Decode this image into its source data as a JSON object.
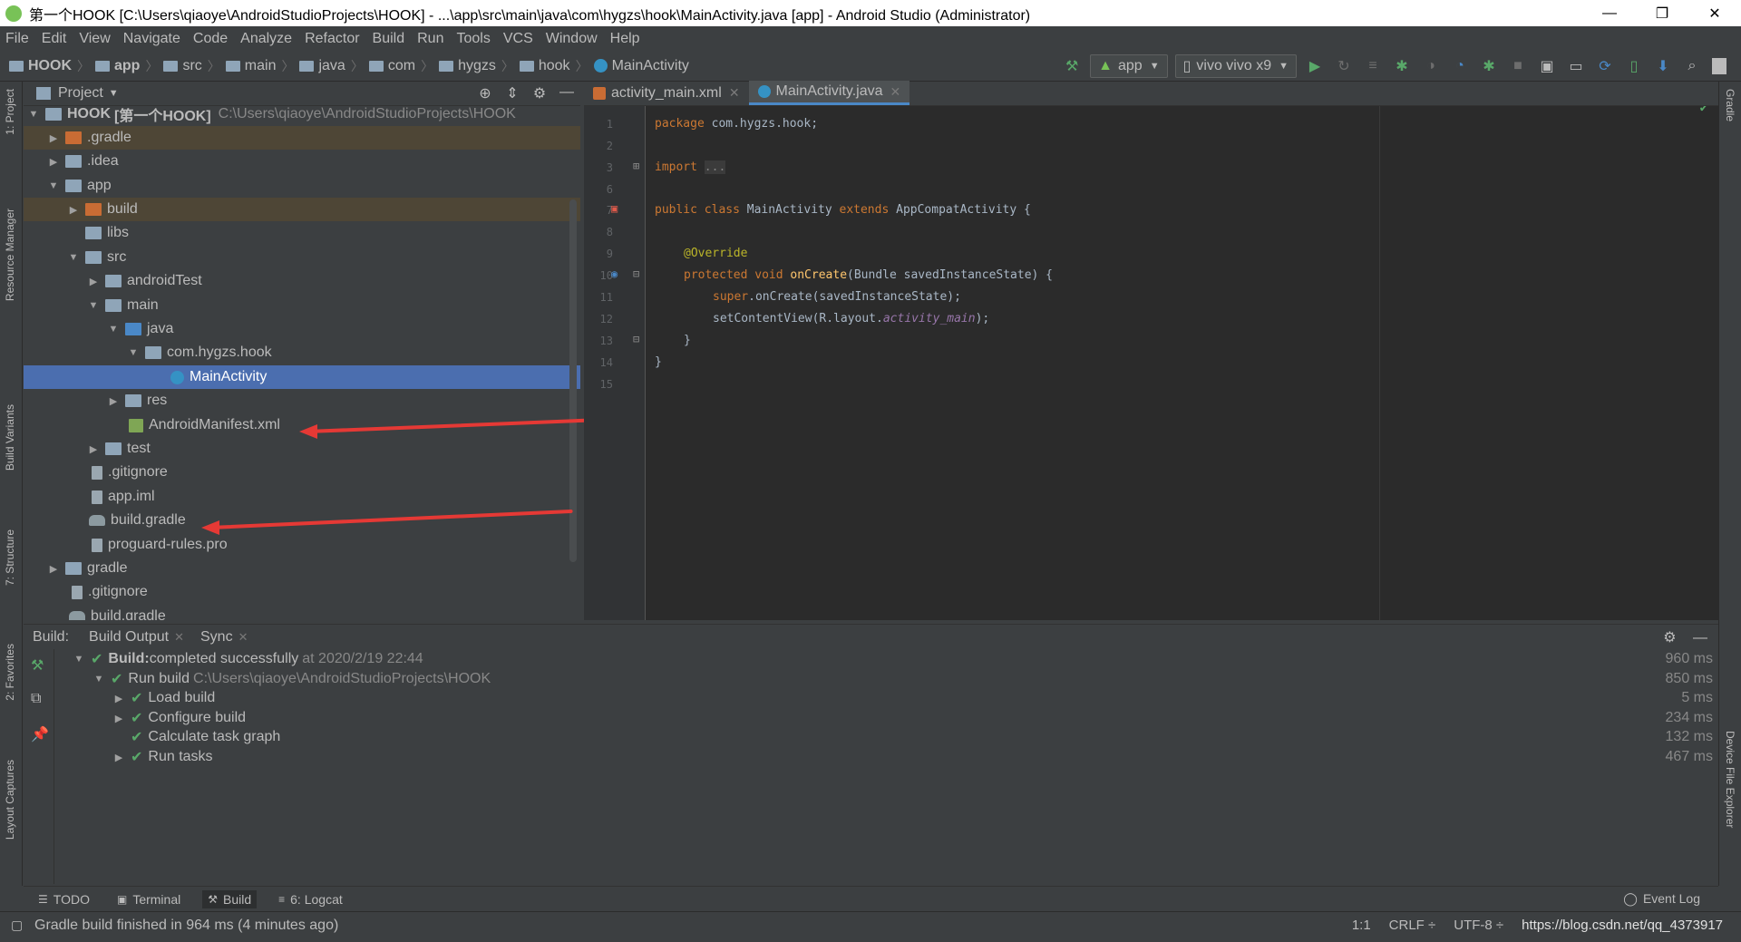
{
  "window": {
    "title": "第一个HOOK [C:\\Users\\qiaoye\\AndroidStudioProjects\\HOOK] - ...\\app\\src\\main\\java\\com\\hygzs\\hook\\MainActivity.java [app] - Android Studio (Administrator)",
    "minimize": "—",
    "maximize": "❐",
    "close": "✕"
  },
  "menu": [
    "File",
    "Edit",
    "View",
    "Navigate",
    "Code",
    "Analyze",
    "Refactor",
    "Build",
    "Run",
    "Tools",
    "VCS",
    "Window",
    "Help"
  ],
  "breadcrumb": [
    "HOOK",
    "app",
    "src",
    "main",
    "java",
    "com",
    "hygzs",
    "hook",
    "MainActivity"
  ],
  "toolbar": {
    "run_config": "app",
    "device": "vivo vivo x9"
  },
  "left_stripe": {
    "project": "1: Project",
    "resource_manager": "Resource Manager",
    "build_variants": "Build Variants",
    "structure": "7: Structure",
    "favorites": "2: Favorites",
    "layout_captures": "Layout Captures"
  },
  "right_stripe": {
    "gradle": "Gradle",
    "device_file_explorer": "Device File Explorer"
  },
  "project_panel": {
    "title": "Project",
    "root_name": "HOOK",
    "root_module": "[第一个HOOK]",
    "root_path": "C:\\Users\\qiaoye\\AndroidStudioProjects\\HOOK",
    "items": [
      {
        "label": ".gradle"
      },
      {
        "label": ".idea"
      },
      {
        "label": "app"
      },
      {
        "label": "build"
      },
      {
        "label": "libs"
      },
      {
        "label": "src"
      },
      {
        "label": "androidTest"
      },
      {
        "label": "main"
      },
      {
        "label": "java"
      },
      {
        "label": "com.hygzs.hook"
      },
      {
        "label": "MainActivity"
      },
      {
        "label": "res"
      },
      {
        "label": "AndroidManifest.xml"
      },
      {
        "label": "test"
      },
      {
        "label": ".gitignore"
      },
      {
        "label": "app.iml"
      },
      {
        "label": "build.gradle"
      },
      {
        "label": "proguard-rules.pro"
      },
      {
        "label": "gradle"
      },
      {
        "label": ".gitignore"
      },
      {
        "label": "build.gradle"
      }
    ]
  },
  "editor": {
    "tabs": [
      {
        "label": "activity_main.xml"
      },
      {
        "label": "MainActivity.java"
      }
    ],
    "line_numbers": [
      "1",
      "2",
      "3",
      "6",
      "7",
      "8",
      "9",
      "10",
      "11",
      "12",
      "13",
      "14",
      "15"
    ],
    "code": {
      "l1_kw": "package",
      "l1_rest": " com.hygzs.hook;",
      "l3_kw": "import",
      "l3_fold": "...",
      "l7_kw": "public class",
      "l7_name": " MainActivity ",
      "l7_kw2": "extends",
      "l7_rest": " AppCompatActivity {",
      "l9_ann": "@Override",
      "l10_kw": "protected void",
      "l10_fn": " onCreate",
      "l10_rest": "(Bundle savedInstanceState) {",
      "l11_kw": "super",
      "l11_rest": ".onCreate(savedInstanceState);",
      "l12_pre": "setContentView(R.layout.",
      "l12_fld": "activity_main",
      "l12_post": ");",
      "l13": "}",
      "l14": "}"
    }
  },
  "build_panel": {
    "label": "Build:",
    "tabs": [
      "Build Output",
      "Sync"
    ],
    "rows": [
      {
        "title": "Build:",
        "text": " completed successfully",
        "dim": " at 2020/2/19 22:44",
        "time": "960 ms"
      },
      {
        "text": "Run build",
        "dim": "C:\\Users\\qiaoye\\AndroidStudioProjects\\HOOK",
        "time": "850 ms"
      },
      {
        "text": "Load build",
        "time": "5 ms"
      },
      {
        "text": "Configure build",
        "time": "234 ms"
      },
      {
        "text": "Calculate task graph",
        "time": "132 ms"
      },
      {
        "text": "Run tasks",
        "time": "467 ms"
      }
    ]
  },
  "bottom_tabs": {
    "todo": "TODO",
    "terminal": "Terminal",
    "build": "Build",
    "logcat": "6: Logcat",
    "event_log": "Event Log"
  },
  "status": {
    "message": "Gradle build finished in 964 ms (4 minutes ago)",
    "position": "1:1",
    "line_sep": "CRLF ÷",
    "encoding": "UTF-8 ÷",
    "watermark": "https://blog.csdn.net/qq_4373917"
  }
}
